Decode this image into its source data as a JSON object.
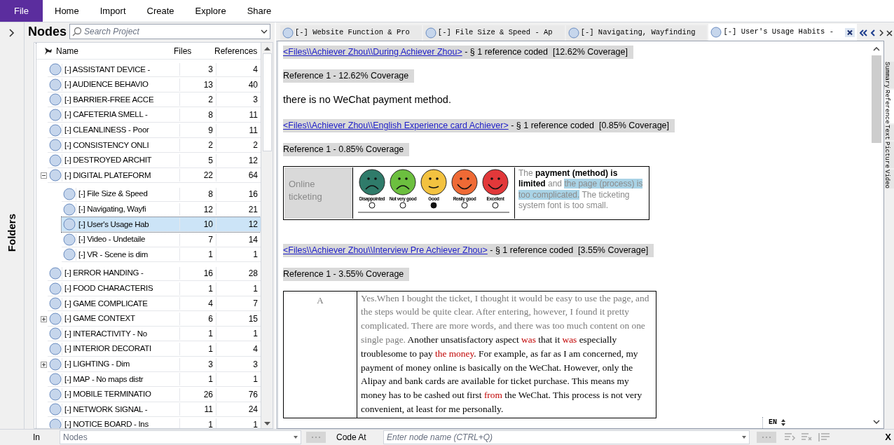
{
  "menu": [
    {
      "label": "File",
      "selected": true
    },
    {
      "label": "Home",
      "selected": false
    },
    {
      "label": "Import",
      "selected": false
    },
    {
      "label": "Create",
      "selected": false
    },
    {
      "label": "Explore",
      "selected": false
    },
    {
      "label": "Share",
      "selected": false
    }
  ],
  "folders_label": "Folders",
  "nodes_panel": {
    "title": "Nodes",
    "search": {
      "placeholder": "Search Project"
    },
    "columns": [
      "Name",
      "Files",
      "References"
    ],
    "nodes": [
      {
        "name": "[-] ASSISTANT DEVICE -",
        "files": "3",
        "references": "4",
        "selected": false
      },
      {
        "name": "[-] AUDIENCE BEHAVIO",
        "files": "13",
        "references": "40",
        "selected": false
      },
      {
        "name": "[-] BARRIER-FREE ACCE",
        "files": "2",
        "references": "3",
        "selected": false
      },
      {
        "name": "[-] CAFETERIA SMELL -",
        "files": "8",
        "references": "11",
        "selected": false
      },
      {
        "name": "[-] CLEANLINESS - Poor",
        "files": "9",
        "references": "11",
        "selected": false
      },
      {
        "name": "[-] CONSISTENCY ONLI",
        "files": "2",
        "references": "2",
        "selected": false
      },
      {
        "name": "[-] DESTROYED ARCHIT",
        "files": "5",
        "references": "12",
        "selected": false
      },
      {
        "name": "[-] DIGITAL PLATEFORM",
        "files": "22",
        "references": "64",
        "selected": false,
        "expanded": true,
        "children": [
          {
            "name": "[-] File Size & Speed",
            "files": "8",
            "references": "16",
            "selected": false
          },
          {
            "name": "[-] Navigating, Wayfi",
            "files": "12",
            "references": "21",
            "selected": false
          },
          {
            "name": "[-] User's Usage Hab",
            "files": "10",
            "references": "12",
            "selected": true
          },
          {
            "name": "[-] Video - Undetaile",
            "files": "7",
            "references": "14",
            "selected": false
          },
          {
            "name": "[-] VR - Scene is dim",
            "files": "1",
            "references": "1",
            "selected": false
          }
        ]
      },
      {
        "name": "[-] ERROR HANDING -",
        "files": "16",
        "references": "28",
        "selected": false
      },
      {
        "name": "[-] FOOD CHARACTERIS",
        "files": "1",
        "references": "1",
        "selected": false
      },
      {
        "name": "[-] GAME COMPLICATE",
        "files": "4",
        "references": "7",
        "selected": false
      },
      {
        "name": "[-] GAME CONTEXT",
        "files": "6",
        "references": "15",
        "selected": false,
        "expanded": false
      },
      {
        "name": "[-] INTERACTIVITY - No",
        "files": "1",
        "references": "1",
        "selected": false
      },
      {
        "name": "[-] INTERIOR DECORATI",
        "files": "1",
        "references": "4",
        "selected": false
      },
      {
        "name": "[-] LIGHTING - Dim",
        "files": "3",
        "references": "3",
        "selected": false,
        "expanded": false
      },
      {
        "name": "[-] MAP - No maps distr",
        "files": "1",
        "references": "1",
        "selected": false
      },
      {
        "name": "[-] MOBILE TERMINATIO",
        "files": "26",
        "references": "76",
        "selected": false
      },
      {
        "name": "[-] NETWORK SIGNAL -",
        "files": "11",
        "references": "24",
        "selected": false
      },
      {
        "name": "[-] NOTICE BOARD - Ins",
        "files": "1",
        "references": "1",
        "selected": false
      }
    ]
  },
  "doc_tabs": [
    {
      "label": "[-] Website Function & Pro",
      "selected": false
    },
    {
      "label": "[-] File Size & Speed - Ap",
      "selected": false
    },
    {
      "label": "[-] Navigating, Wayfinding",
      "selected": false
    },
    {
      "label": "[-] User's Usage Habits -",
      "selected": true
    }
  ],
  "content": [
    {
      "kind": "source",
      "link": "<Files\\\\Achiever Zhou\\\\During Achiever Zhou>",
      "text": "- § 1 reference coded  [12.62% Coverage]"
    },
    {
      "kind": "reference",
      "text": "Reference 1 - 12.62% Coverage"
    },
    {
      "kind": "quote",
      "text": "there is no WeChat payment method."
    },
    {
      "kind": "source",
      "link": "<Files\\\\Achiever Zhou\\\\English Experience card Achiever>",
      "text": "- § 1 reference coded  [0.85% Coverage]"
    },
    {
      "kind": "reference",
      "text": "Reference 1 - 0.85% Coverage"
    },
    {
      "kind": "survey",
      "label": "Online ticketing",
      "faces": [
        {
          "label": "Disappointed",
          "color": "#2f7b6a",
          "kind": "frown",
          "selected": false
        },
        {
          "label": "Not very good",
          "color": "#6cbf3f",
          "kind": "frown",
          "selected": false
        },
        {
          "label": "Good",
          "color": "#f3c240",
          "kind": "smile",
          "selected": true
        },
        {
          "label": "Really good",
          "color": "#ef6a35",
          "kind": "grin",
          "selected": false
        },
        {
          "label": "Excellent",
          "color": "#e2383a",
          "kind": "grin",
          "selected": false
        }
      ],
      "comment": [
        {
          "text": "The ",
          "kind": "muted"
        },
        {
          "text": "payment (method) is limited",
          "kind": "bold"
        },
        {
          "text": " and ",
          "kind": "muted"
        },
        {
          "text": "the page (process) is too complicated.",
          "kind": "highlight"
        },
        {
          "text": " The ticketing system font is too small.",
          "kind": "muted"
        }
      ]
    },
    {
      "kind": "source",
      "link": "<Files\\\\Achiever Zhou\\\\Interview Pre Achiever Zhou>",
      "text": "- § 1 reference coded  [3.55% Coverage]"
    },
    {
      "kind": "reference",
      "text": "Reference 1 - 3.55% Coverage"
    },
    {
      "kind": "interview",
      "speaker": "A",
      "segments": [
        {
          "text": "Yes.When I bought the ticket, I thought it would be easy to use the page, and the steps would be quite clear. After entering, however, I found it pretty complicated. There are more words, and there was too much content on one single page. ",
          "kind": "muted"
        },
        {
          "text": "Another unsatisfactory aspect ",
          "kind": "plain"
        },
        {
          "text": "was",
          "kind": "red"
        },
        {
          "text": " that it ",
          "kind": "plain"
        },
        {
          "text": "was",
          "kind": "red"
        },
        {
          "text": " especially troublesome to pay ",
          "kind": "plain"
        },
        {
          "text": "the money",
          "kind": "red"
        },
        {
          "text": ". For example, as far as I am concerned, my payment of money online is basically on the WeChat. However, only the Alipay and bank cards are available for ticket purchase. This means my money has to be cashed out first ",
          "kind": "plain"
        },
        {
          "text": "from",
          "kind": "red"
        },
        {
          "text": " the WeChat. This process is not very convenient, at least for me personally.",
          "kind": "plain"
        }
      ]
    }
  ],
  "side_tabs": [
    {
      "label": "Summary",
      "selected": false
    },
    {
      "label": "Reference",
      "selected": true
    },
    {
      "label": "Text",
      "selected": false
    },
    {
      "label": "Picture",
      "selected": false
    },
    {
      "label": "Video",
      "selected": false
    }
  ],
  "language": "EN",
  "bottom_bar": {
    "in_label": "In",
    "in_field": {
      "placeholder": "Nodes"
    },
    "code_at_label": "Code At",
    "code_field": {
      "placeholder": "Enter node name (CTRL+Q)"
    },
    "close": "X"
  }
}
